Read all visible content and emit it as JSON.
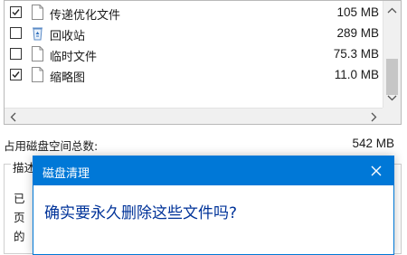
{
  "files": [
    {
      "name": "传递优化文件",
      "size": "105 MB",
      "checked": true,
      "icon": "blank-file-icon"
    },
    {
      "name": "回收站",
      "size": "289 MB",
      "checked": false,
      "icon": "recycle-bin-icon"
    },
    {
      "name": "临时文件",
      "size": "75.3 MB",
      "checked": false,
      "icon": "blank-file-icon"
    },
    {
      "name": "缩略图",
      "size": "11.0 MB",
      "checked": true,
      "icon": "blank-file-icon"
    }
  ],
  "total": {
    "label": "占用磁盘空间总数:",
    "value": "542 MB"
  },
  "description": {
    "legend": "描述",
    "lines": [
      "已",
      "页",
      "的"
    ]
  },
  "dialog": {
    "title": "磁盘清理",
    "message": "确实要永久删除这些文件吗?"
  },
  "colors": {
    "accent": "#0078d7",
    "message": "#003399"
  }
}
